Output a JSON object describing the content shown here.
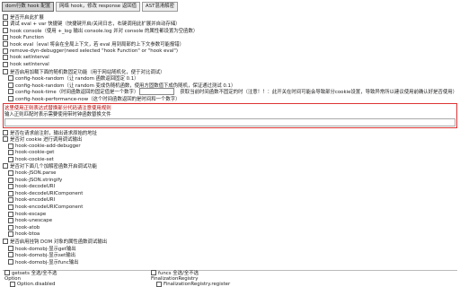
{
  "tabs": [
    "dom行数 hook 配置",
    "网络 hook，修改 response 返回值",
    "AST混淆解密"
  ],
  "options": [
    {
      "label": "是否开启此扩展",
      "indent": 0
    },
    {
      "label": "调试 eval + var 快捷键（快捷键开启/关闭日志，右键调用此扩展并自动存储）",
      "indent": 0
    },
    {
      "label": "hook console（使用 +_log 输出 console.log 并对 console 的属性都设置为空函数）",
      "indent": 0
    },
    {
      "label": "hook Function",
      "indent": 0
    },
    {
      "label": "hook eval（eval 将会在全局上下文，若 eval 用到局部的上下文参数可能报错）",
      "indent": 0
    },
    {
      "label": "remove-dyn-debugger(need selected \"hook Function\" or \"hook eval\")",
      "indent": 0
    },
    {
      "label": "hook setInterval",
      "indent": 0
    },
    {
      "label": "hook setInterval",
      "indent": 0
    },
    {
      "label": "是否启用加载下面的随机数固定功能（用于网站随机化，便于对比调试）",
      "indent": 0
    },
    {
      "label": "config-hook-random（让 random 函数返回固定 0.1）",
      "indent": 1
    },
    {
      "label": "config-hook-random（让 random 变成伪随机函数，使用方固数值下成伪随机，保证通过测试 0.1）",
      "indent": 1
    },
    {
      "label": "config-hook-time（时间函数返回的固定值是一个数字）",
      "indent": 1,
      "input": true,
      "note": "获取当前时间函数不固定的时（注意！！：此开关在时间可能会导致部分cookie设置，导致异常所以建议使用前确认好是否使用）"
    },
    {
      "label": "config-hook-performance-now（这个时间函数返回的是时间和一个数字）",
      "indent": 1
    }
  ],
  "warning_box": {
    "label": "这里使用正则表达式替换部分代码请注意使用规则",
    "hint": "输入正则匹配时表示需要使用带时钟函数替换文件"
  },
  "options2": [
    {
      "label": "是否在请求前注射，输出请求原始的地址",
      "indent": 0
    },
    {
      "label": "是否对 cookie 进行调用调试输出",
      "indent": 0
    },
    {
      "label": "hook-cookie-add-debugger",
      "indent": 1
    },
    {
      "label": "hook-cookie-get",
      "indent": 1
    },
    {
      "label": "hook-cookie-set",
      "indent": 1
    },
    {
      "label": "是否对下面几个加解密函数开启调试功能",
      "indent": 0
    },
    {
      "label": "hook-JSON.parse",
      "indent": 1
    },
    {
      "label": "hook-JSON.stringify",
      "indent": 1
    },
    {
      "label": "hook-decodeURI",
      "indent": 1
    },
    {
      "label": "hook-decodeURIComponent",
      "indent": 1
    },
    {
      "label": "hook-encodeURI",
      "indent": 1
    },
    {
      "label": "hook-encodeURIComponent",
      "indent": 1
    },
    {
      "label": "hook-escape",
      "indent": 1
    },
    {
      "label": "hook-unescape",
      "indent": 1
    },
    {
      "label": "hook-atob",
      "indent": 1
    },
    {
      "label": "hook-btoa",
      "indent": 1
    },
    {
      "label": "是否启用挂钩 DOM 对象的属性函数调试输出",
      "indent": 0
    },
    {
      "label": "hook-domobj-显示get输出",
      "indent": 1
    },
    {
      "label": "hook-domobj-显示set输出",
      "indent": 1
    },
    {
      "label": "hook-domobj-显示func输出",
      "indent": 1
    }
  ],
  "bottom_left": [
    {
      "label": "getsets 全选/全不选",
      "check": true
    },
    {
      "label": "Option",
      "check": false
    },
    {
      "label": "Option.disabled",
      "check": true,
      "indent": true
    }
  ],
  "bottom_right": [
    {
      "label": "funcs 全选/全不选",
      "check": true
    },
    {
      "label": "FinalizationRegistry",
      "check": false
    },
    {
      "label": "FinalizationRegistry.register",
      "check": true,
      "indent": true
    }
  ]
}
